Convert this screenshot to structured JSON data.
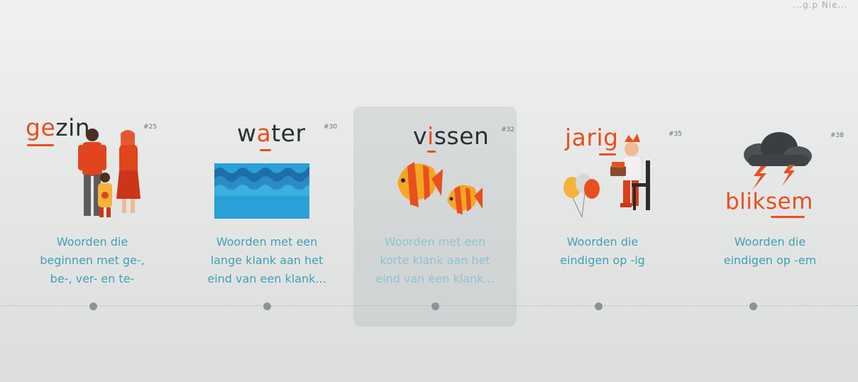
{
  "topbar": {
    "text": "...g.p  Nie..."
  },
  "cards": [
    {
      "word_hl": "ge",
      "word_rest": "zin",
      "number": "#25",
      "desc": [
        "Woorden die",
        "beginnen met ge-,",
        "be-, ver- en te-"
      ],
      "selected": false
    },
    {
      "word_pre": "w",
      "word_hl": "a",
      "word_rest": "ter",
      "number": "#30",
      "desc": [
        "Woorden met een",
        "lange klank aan het",
        "eind van een klank..."
      ],
      "selected": false
    },
    {
      "word_pre": "v",
      "word_hl": "i",
      "word_rest": "ssen",
      "number": "#32",
      "desc": [
        "Woorden met een",
        "korte klank aan het",
        "eind van een klank..."
      ],
      "selected": true
    },
    {
      "word_pre": "jar",
      "word_hl": "ig",
      "number": "#35",
      "desc": [
        "Woorden die",
        "eindigen op -ig"
      ],
      "selected": false
    },
    {
      "word_pre": "blik",
      "word_hl": "sem",
      "number": "#38",
      "desc": [
        "Woorden die",
        "eindigen op -em"
      ],
      "selected": false
    }
  ],
  "colors": {
    "accent": "#e8501e",
    "link": "#3fa0b8",
    "timeline_dot": "#8e9396"
  },
  "icons": [
    "family-icon",
    "waves-icon",
    "fish-icon",
    "birthday-icon",
    "thunderstorm-icon"
  ]
}
